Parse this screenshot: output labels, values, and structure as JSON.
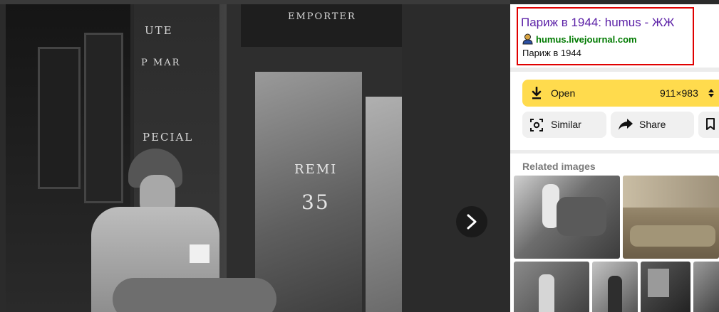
{
  "viewer": {
    "photo_texts": [
      "UTE",
      "P MAR",
      "PECIAL",
      "EMPORTER",
      "REMI",
      "35"
    ],
    "next_icon": "chevron-right-icon"
  },
  "source": {
    "title": "Париж в 1944: humus - ЖЖ",
    "domain": "humus.livejournal.com",
    "description": "Париж в 1944",
    "user_icon": "user-icon"
  },
  "actions": {
    "open_label": "Open",
    "size_label": "911×983",
    "similar_label": "Similar",
    "share_label": "Share",
    "accent_color": "#ffdb4d"
  },
  "related": {
    "title": "Related images"
  },
  "colors": {
    "title_link": "#5a1fa6",
    "domain_link": "#007a00",
    "highlight_border": "#e00000"
  }
}
